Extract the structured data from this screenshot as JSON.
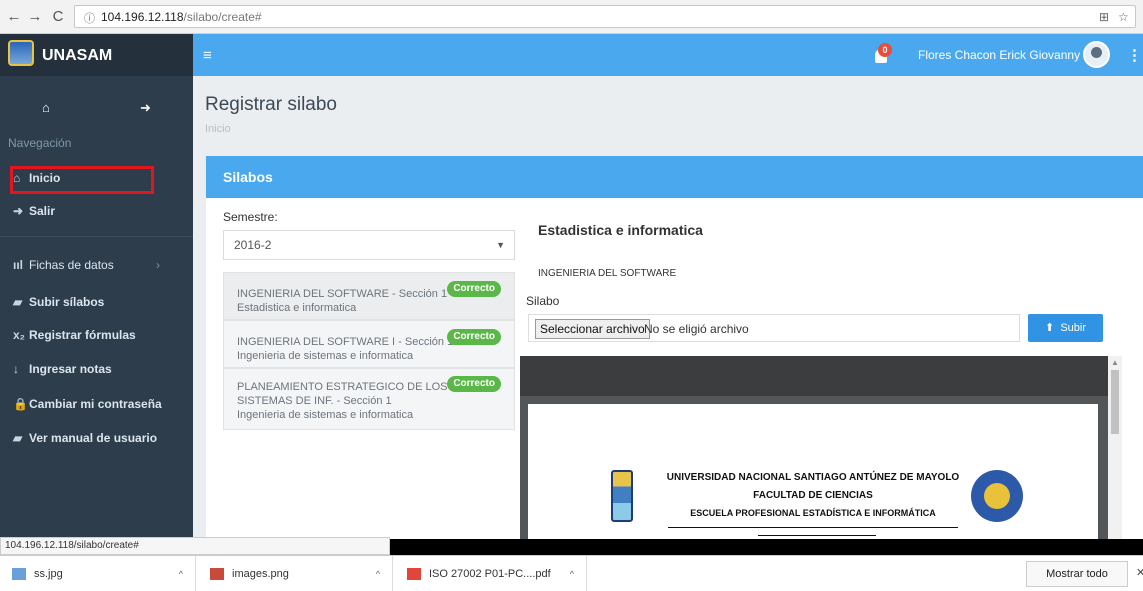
{
  "browser": {
    "url_host": "104.196.12.118",
    "url_path": "/silabo/create#",
    "back": "←",
    "forward": "→",
    "reload": "C",
    "info": "ⓘ"
  },
  "app": {
    "brand": "UNASAM",
    "user": "Flores Chacon Erick Giovanny",
    "notifications": "0"
  },
  "sidebar": {
    "section": "Navegación",
    "items": [
      {
        "icon": "⌂",
        "label": "Inicio"
      },
      {
        "icon": "➜",
        "label": "Salir"
      },
      {
        "icon": "ııl",
        "label": "Fichas de datos"
      },
      {
        "icon": "▰",
        "label": "Subir sílabos"
      },
      {
        "icon": "x₂",
        "label": "Registrar fórmulas"
      },
      {
        "icon": "↓",
        "label": "Ingresar notas"
      },
      {
        "icon": "🔒",
        "label": "Cambiar mi contraseña"
      },
      {
        "icon": "▰",
        "label": "Ver manual de usuario"
      }
    ]
  },
  "page": {
    "title": "Registrar silabo",
    "breadcrumb": "Inicio"
  },
  "panel": {
    "title": "Silabos",
    "semester_label": "Semestre:",
    "semester_value": "2016-2",
    "courses": [
      {
        "name": "INGENIERIA DEL SOFTWARE - Sección 1",
        "school": "Estadistica e informatica",
        "status": "Correcto"
      },
      {
        "name": "INGENIERIA DEL SOFTWARE I - Sección 1",
        "school": "Ingenieria de sistemas e informatica",
        "status": "Correcto"
      },
      {
        "name1": "PLANEAMIENTO ESTRATEGICO DE LOS",
        "name2": "SISTEMAS DE INF. - Sección 1",
        "school": "Ingenieria de sistemas e informatica",
        "status": "Correcto"
      }
    ],
    "detail_title": "Estadistica e informatica",
    "detail_course": "INGENIERIA DEL SOFTWARE",
    "file_label": "Silabo",
    "file_button": "Seleccionar archivo",
    "file_status": "No se eligió archivo",
    "upload_button": "Subir"
  },
  "document": {
    "line1": "UNIVERSIDAD NACIONAL SANTIAGO ANTÚNEZ DE MAYOLO",
    "line2": "FACULTAD DE CIENCIAS",
    "line3": "ESCUELA PROFESIONAL ESTADÍSTICA E INFORMÁTICA"
  },
  "status_url": "104.196.12.118/silabo/create#",
  "downloads": {
    "items": [
      "ss.jpg",
      "images.png",
      "ISO 27002 P01-PC....pdf"
    ],
    "show_all": "Mostrar todo"
  }
}
